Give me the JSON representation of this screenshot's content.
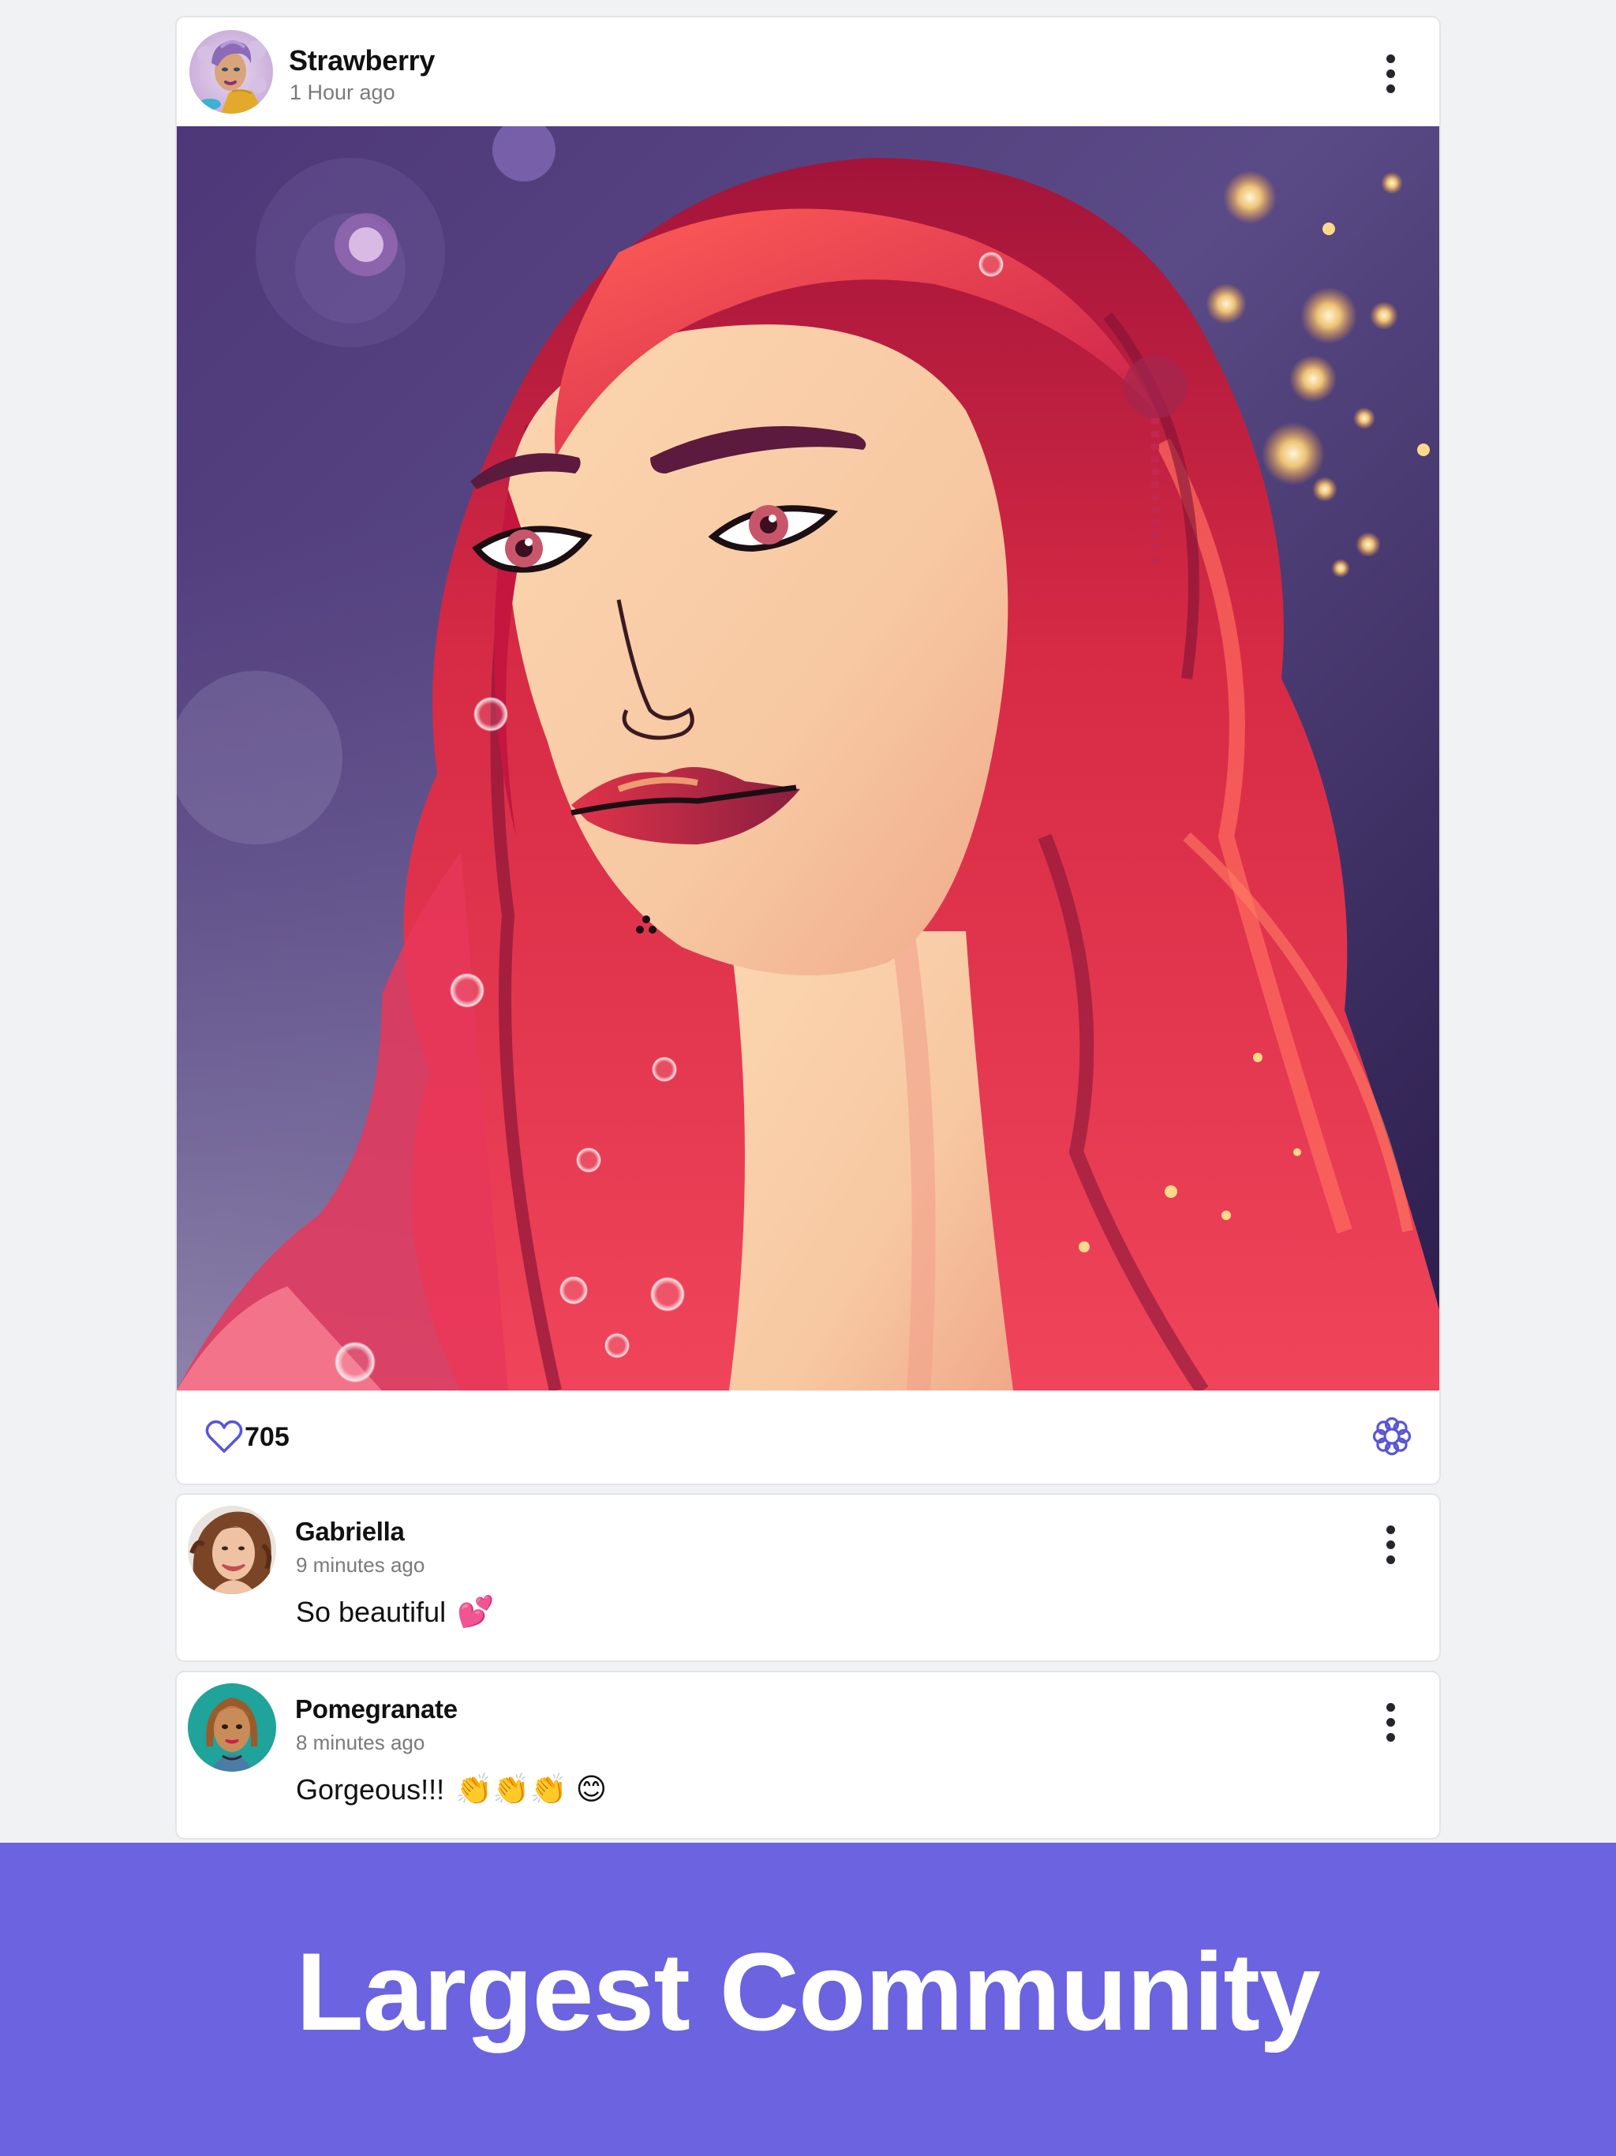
{
  "post": {
    "author": {
      "name": "Strawberry",
      "timestamp": "1 Hour ago",
      "avatar_icon": "avatar-purple-hair-illustration"
    },
    "menu_icon": "vertical-ellipsis-icon",
    "image": {
      "description": "Illustrated portrait of a woman with long wavy red hair on a purple bokeh background"
    },
    "footer": {
      "like_icon": "heart-outline-icon",
      "like_count": "705",
      "flower_icon": "flower-outline-icon"
    }
  },
  "comments": [
    {
      "author": "Gabriella",
      "timestamp": "9 minutes ago",
      "text": "So beautiful",
      "emoji": "💕",
      "avatar_icon": "avatar-curly-brown-hair-photo"
    },
    {
      "author": "Pomegranate",
      "timestamp": "8 minutes ago",
      "text": "Gorgeous!!!",
      "emoji": "👏👏👏 😊",
      "avatar_icon": "avatar-bob-hair-illustration"
    }
  ],
  "banner": {
    "title": "Largest Community"
  },
  "colors": {
    "page_background": "#F1F2F4",
    "card_background": "#FFFFFF",
    "accent": "#6B63DF",
    "icon_accent": "#5B54D6",
    "text_primary": "#111111",
    "text_secondary": "#7A7A7A"
  }
}
